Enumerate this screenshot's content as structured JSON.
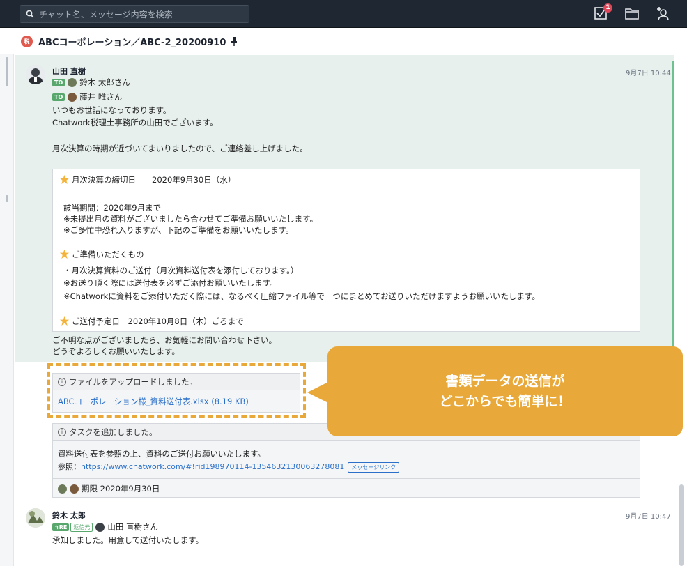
{
  "search": {
    "placeholder": "チャット名、メッセージ内容を検索"
  },
  "topbar": {
    "task_badge": "1"
  },
  "room": {
    "icon_text": "税",
    "title": "ABCコーポレーション／ABC-2_20200910"
  },
  "message1": {
    "sender": "山田 直樹",
    "time": "9月7日 10:44",
    "to1": "鈴木 太郎さん",
    "to2": "藤井 唯さん",
    "to_label": "TO",
    "lines": [
      "いつもお世話になっております。",
      "Chatwork税理士事務所の山田でございます。",
      "月次決算の時期が近づいてまいりましたので、ご連絡差し上げました。"
    ],
    "quote": {
      "q1": "月次決算の締切日　　2020年9月30日（水）",
      "q2": "該当期間：2020年9月まで",
      "q3": "※未提出月の資料がございましたら合わせてご準備お願いいたします。",
      "q4": "※ご多忙中恐れ入りますが、下記のご準備をお願いいたします。",
      "q5": "ご準備いただくもの",
      "q6": "・月次決算資料のご送付（月次資料送付表を添付しております。）",
      "q7": "※お送り頂く際には送付表を必ずご添付お願いいたします。",
      "q8": "※Chatworkに資料をご添付いただく際には、なるべく圧縮ファイル等で一つにまとめてお送りいただけますようお願いいたします。",
      "q9": "ご送付予定日　2020年10月8日（木）ごろまで"
    },
    "closing1": "ご不明な点がございましたら、お気軽にお問い合わせ下さい。",
    "closing2": "どうぞよろしくお願いいたします。"
  },
  "upload": {
    "header": "ファイルをアップロードしました。",
    "file_link": "ABCコーポレーション様_資料送付表.xlsx (8.19 KB)"
  },
  "task": {
    "header": "タスクを追加しました。",
    "body": "資料送付表を参照の上、資料のご送付お願いいたします。",
    "ref_label": "参照：",
    "ref_link": "https://www.chatwork.com/#!rid198970114-1354632130063278081",
    "msg_link_tag": "メッセージリンク",
    "deadline": "期限 2020年9月30日"
  },
  "callout": {
    "line1": "書類データの送信が",
    "line2": "どこからでも簡単に！"
  },
  "message2": {
    "sender": "鈴木 太郎",
    "time": "9月7日 10:47",
    "re_tag": "RE",
    "reply_tag": "返信元",
    "reply_to": "山田 直樹さん",
    "body": "承知しました。用意して送付いたします。"
  },
  "colors": {
    "accent": "#e8a93a",
    "topbar": "#1f2733",
    "to_green": "#58a86e",
    "link": "#2a6fc9"
  }
}
